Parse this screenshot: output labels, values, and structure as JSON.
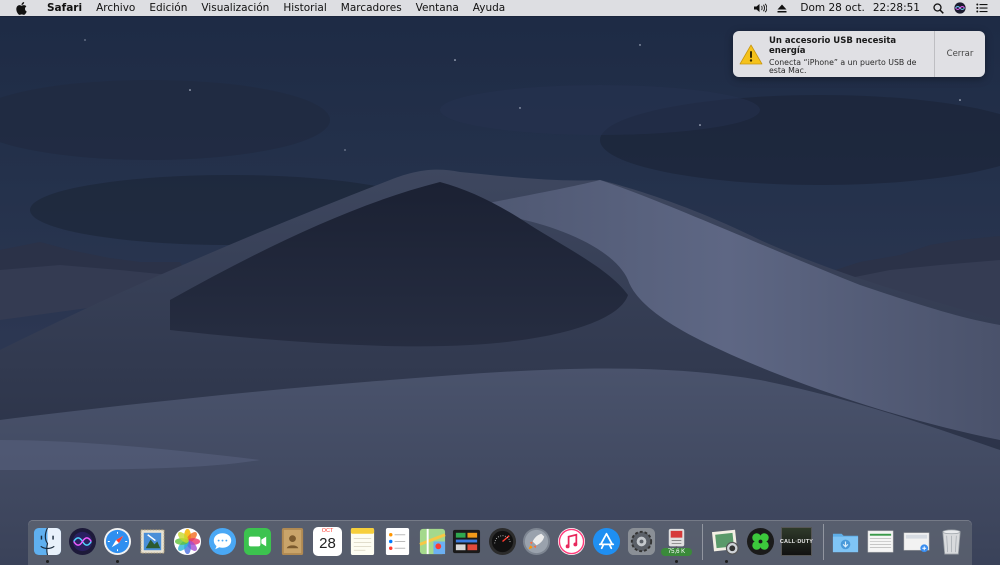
{
  "menubar": {
    "app_name": "Safari",
    "menus": [
      "Archivo",
      "Edición",
      "Visualización",
      "Historial",
      "Marcadores",
      "Ventana",
      "Ayuda"
    ],
    "status_icons": [
      "volume-icon",
      "eject-icon"
    ],
    "date": "Dom 28 oct.",
    "time": "22:28:51"
  },
  "notification": {
    "title": "Un accesorio USB necesita energía",
    "text": "Conecta “iPhone” a un puerto USB de esta Mac.",
    "close_label": "Cerrar"
  },
  "dock": {
    "calendar_day": "28",
    "calendar_month": "OCT",
    "activity_monitor_badge": "75,6 K",
    "game_title": "CALL·DUTY"
  }
}
